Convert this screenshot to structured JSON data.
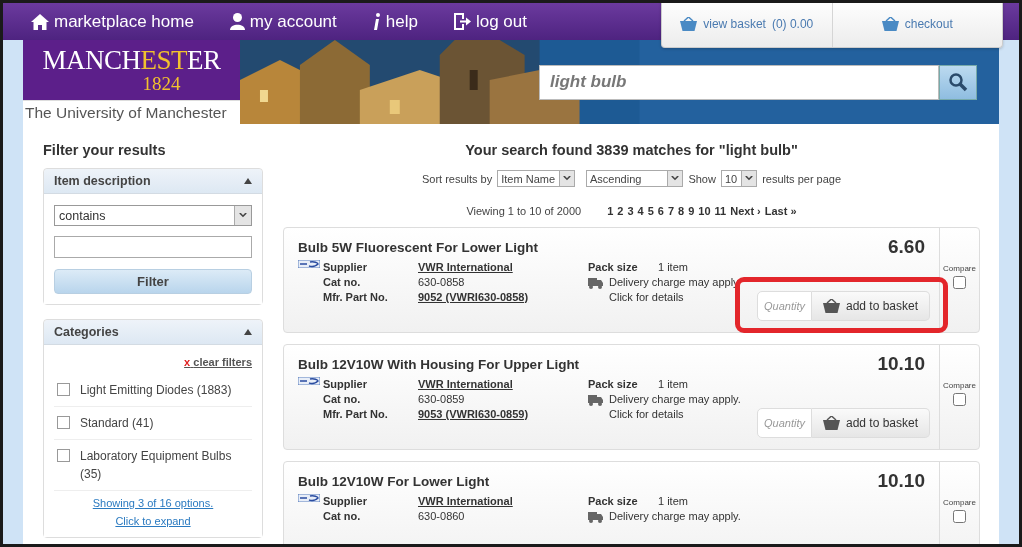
{
  "nav": [
    {
      "kind": "home",
      "label": "marketplace home"
    },
    {
      "kind": "account",
      "label": "my account"
    },
    {
      "kind": "help",
      "label": "help"
    },
    {
      "kind": "logout",
      "label": "log out"
    }
  ],
  "basket": {
    "label": "view basket",
    "count": "(0) 0.00",
    "checkout": "checkout"
  },
  "logo": {
    "parts": [
      {
        "text": "MANCH",
        "highlight": false
      },
      {
        "text": "EST",
        "highlight": true
      },
      {
        "text": "ER",
        "highlight": false
      }
    ],
    "year": "1824",
    "university": "The University of Manchester"
  },
  "search": {
    "value": "light bulb"
  },
  "filter": {
    "title": "Filter your results",
    "item_description": {
      "title": "Item description",
      "expanded": true,
      "mode": "contains",
      "button": "Filter"
    },
    "categories": {
      "title": "Categories",
      "expanded": true,
      "clear": "clear filters",
      "clear_mark": "x",
      "items": [
        {
          "label": "Light Emitting Diodes (1883)",
          "checked": false
        },
        {
          "label": "Standard (41)",
          "checked": false
        },
        {
          "label": "Laboratory Equipment Bulbs (35)",
          "checked": false
        }
      ],
      "showing": "Showing 3 of 16 options.",
      "expand": "Click to expand"
    }
  },
  "results": {
    "heading": "Your search found 3839 matches for \"light bulb\"",
    "sort_label": "Sort results by",
    "sort_by": "Item Name",
    "order": "Ascending",
    "show_label": "Show",
    "per_page": "10",
    "per_page_label": "results per page",
    "viewing": "Viewing 1 to 10 of 2000",
    "pages": [
      "1",
      "2",
      "3",
      "4",
      "5",
      "6",
      "7",
      "8",
      "9",
      "10",
      "11"
    ],
    "next": "Next ›",
    "last": "Last »",
    "products": [
      {
        "title": "Bulb 5W Fluorescent For Lower Light",
        "price": "6.60",
        "supplier_label": "Supplier",
        "supplier": "VWR International",
        "cat_label": "Cat no.",
        "cat": "630-0858",
        "mfr_label": "Mfr. Part No.",
        "mfr": "9052 (VWRI630-0858)",
        "pack_label": "Pack size",
        "pack": "1 item",
        "delivery": "Delivery charge may apply",
        "details": "Click for details",
        "quantity_placeholder": "Quantity",
        "add": "add to basket",
        "compare": "Compare",
        "compared": false,
        "highlighted": true
      },
      {
        "title": "Bulb 12V10W With Housing For Upper Light",
        "price": "10.10",
        "supplier_label": "Supplier",
        "supplier": "VWR International",
        "cat_label": "Cat no.",
        "cat": "630-0859",
        "mfr_label": "Mfr. Part No.",
        "mfr": "9053 (VWRI630-0859)",
        "pack_label": "Pack size",
        "pack": "1 item",
        "delivery": "Delivery charge may apply.",
        "details": "Click for details",
        "quantity_placeholder": "Quantity",
        "add": "add to basket",
        "compare": "Compare",
        "compared": false,
        "highlighted": false
      },
      {
        "title": "Bulb 12V10W For Lower Light",
        "price": "10.10",
        "supplier_label": "Supplier",
        "supplier": "VWR International",
        "cat_label": "Cat no.",
        "cat": "630-0860",
        "pack_label": "Pack size",
        "pack": "1 item",
        "delivery": "Delivery charge may apply.",
        "compare": "Compare",
        "compared": false,
        "highlighted": false
      }
    ]
  }
}
